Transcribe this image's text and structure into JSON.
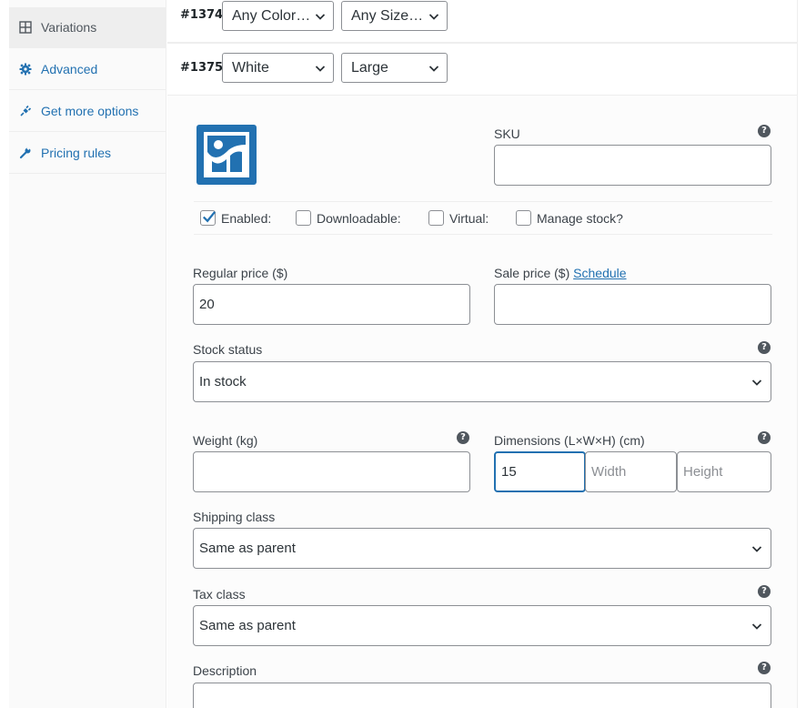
{
  "sidebar": {
    "items": [
      {
        "label": "Variations",
        "icon": "grid-icon",
        "active": true
      },
      {
        "label": "Advanced",
        "icon": "gear-icon",
        "active": false
      },
      {
        "label": "Get more options",
        "icon": "plug-icon",
        "active": false
      },
      {
        "label": "Pricing rules",
        "icon": "wrench-icon",
        "active": false
      }
    ]
  },
  "variations": [
    {
      "id": "#1374",
      "color": "Any Color…",
      "size": "Any Size…"
    },
    {
      "id": "#1375",
      "color": "White",
      "size": "Large"
    }
  ],
  "variation_detail": {
    "image_icon": "image-placeholder-icon",
    "sku_label": "SKU",
    "sku_value": "",
    "checkboxes": [
      {
        "label": "Enabled:",
        "checked": true
      },
      {
        "label": "Downloadable:",
        "checked": false
      },
      {
        "label": "Virtual:",
        "checked": false
      },
      {
        "label": "Manage stock?",
        "checked": false
      }
    ],
    "regular_price_label": "Regular price ($)",
    "regular_price_value": "20",
    "sale_price_label": "Sale price ($)",
    "sale_schedule_link": "Schedule",
    "sale_price_value": "",
    "stock_status_label": "Stock status",
    "stock_status_value": "In stock",
    "weight_label": "Weight (kg)",
    "weight_value": "",
    "dimensions_label": "Dimensions (L×W×H) (cm)",
    "length_value": "15",
    "width_placeholder": "Width",
    "height_placeholder": "Height",
    "shipping_class_label": "Shipping class",
    "shipping_class_value": "Same as parent",
    "tax_class_label": "Tax class",
    "tax_class_value": "Same as parent",
    "description_label": "Description",
    "help_glyph": "?"
  },
  "colors": {
    "link": "#2271b1",
    "border": "#8c8f94",
    "help_bg": "#50575e",
    "focus": "#2271b1"
  }
}
